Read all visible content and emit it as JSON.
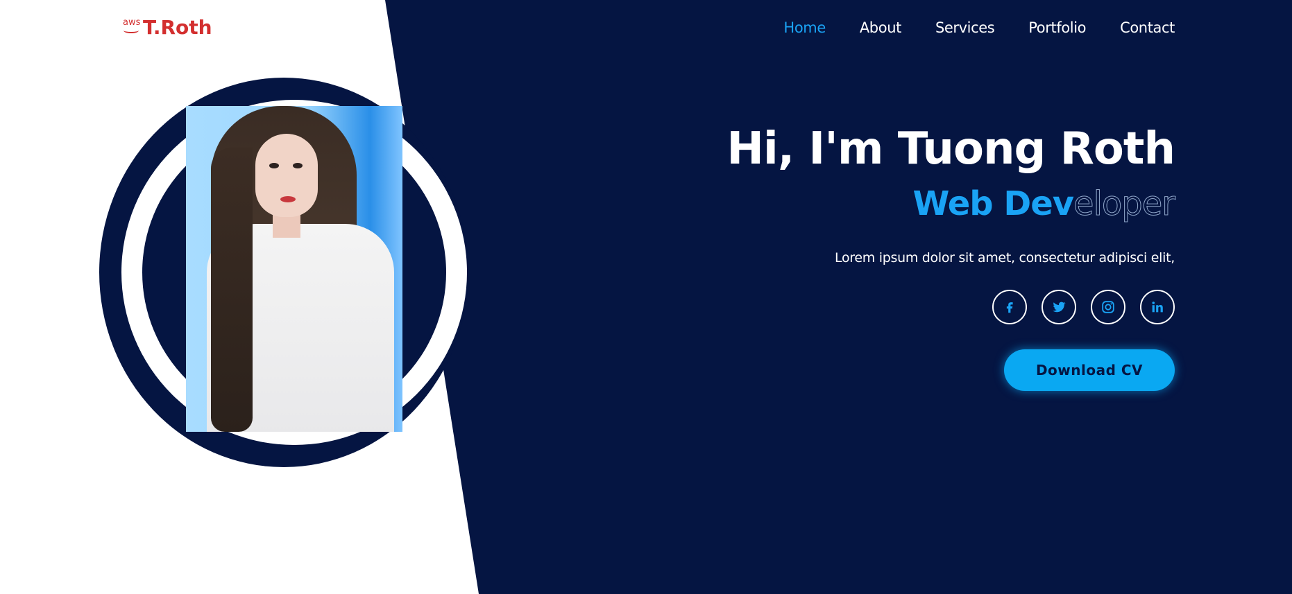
{
  "header": {
    "logo_badge": "aws",
    "logo_name": "T.Roth",
    "nav": [
      {
        "label": "Home",
        "active": true
      },
      {
        "label": "About",
        "active": false
      },
      {
        "label": "Services",
        "active": false
      },
      {
        "label": "Portfolio",
        "active": false
      },
      {
        "label": "Contact",
        "active": false
      }
    ]
  },
  "hero": {
    "title": "Hi, I'm Tuong Roth",
    "role_filled": "Web Dev",
    "role_outline": "eloper",
    "description": "Lorem ipsum dolor sit amet, consectetur adipisci elit,",
    "download_label": "Download CV"
  },
  "socials": [
    {
      "icon": "facebook-icon"
    },
    {
      "icon": "twitter-icon"
    },
    {
      "icon": "instagram-icon"
    },
    {
      "icon": "linkedin-icon"
    }
  ],
  "colors": {
    "dark_bg": "#051542",
    "accent": "#1aa3f5",
    "logo": "#d32f2f",
    "white": "#ffffff"
  }
}
